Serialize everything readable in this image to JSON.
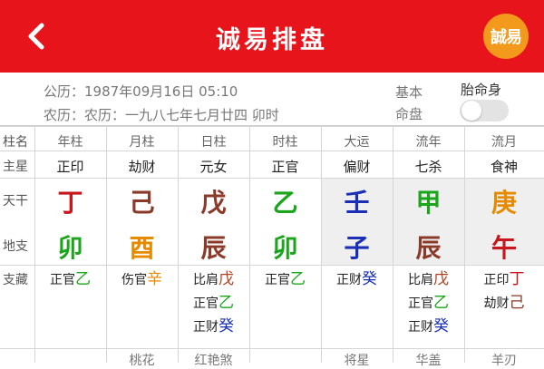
{
  "header": {
    "title": "诚易排盘",
    "logo_text": "誠易",
    "bg": "#e8141c"
  },
  "info": {
    "solar": "公历：1987年09月16日 05:10",
    "lunar": "农历：农历：一九八七年七月廿四 卯时",
    "basic_line1": "基本",
    "basic_line2": "命盘",
    "body_label": "胎命身"
  },
  "row_labels": {
    "name": "柱名",
    "star": "主星",
    "tiangan": "天干",
    "dizhi": "地支",
    "hidden": "支藏"
  },
  "columns": [
    {
      "name": "年柱",
      "star": "正印",
      "gan": "丁",
      "gan_color": "#c8161d",
      "zhi": "卯",
      "zhi_color": "#1aa51a",
      "hidden": [
        {
          "god": "正官",
          "ch": "乙",
          "color": "#1aa51a"
        }
      ],
      "bottom": ""
    },
    {
      "name": "月柱",
      "star": "劫财",
      "gan": "己",
      "gan_color": "#8b3a2a",
      "zhi": "酉",
      "zhi_color": "#e68a00",
      "hidden": [
        {
          "god": "伤官",
          "ch": "辛",
          "color": "#e68a00"
        }
      ],
      "bottom": "桃花"
    },
    {
      "name": "日柱",
      "star": "元女",
      "gan": "戊",
      "gan_color": "#8b3a2a",
      "zhi": "辰",
      "zhi_color": "#8b3a2a",
      "hidden": [
        {
          "god": "比肩",
          "ch": "戊",
          "color": "#b5401f"
        },
        {
          "god": "正官",
          "ch": "乙",
          "color": "#1aa51a"
        },
        {
          "god": "正财",
          "ch": "癸",
          "color": "#1a2fb5"
        }
      ],
      "bottom": "红艳煞"
    },
    {
      "name": "时柱",
      "star": "正官",
      "gan": "乙",
      "gan_color": "#1aa51a",
      "zhi": "卯",
      "zhi_color": "#1aa51a",
      "hidden": [
        {
          "god": "正官",
          "ch": "乙",
          "color": "#1aa51a"
        }
      ],
      "bottom": ""
    },
    {
      "name": "大运",
      "star": "偏财",
      "gan": "壬",
      "gan_color": "#1a2fb5",
      "zhi": "子",
      "zhi_color": "#1a2fb5",
      "hidden": [
        {
          "god": "正财",
          "ch": "癸",
          "color": "#1a2fb5"
        }
      ],
      "bottom": "将星"
    },
    {
      "name": "流年",
      "star": "七杀",
      "gan": "甲",
      "gan_color": "#1aa51a",
      "zhi": "辰",
      "zhi_color": "#8b3a2a",
      "hidden": [
        {
          "god": "比肩",
          "ch": "戊",
          "color": "#b5401f"
        },
        {
          "god": "正官",
          "ch": "乙",
          "color": "#1aa51a"
        },
        {
          "god": "正财",
          "ch": "癸",
          "color": "#1a2fb5"
        }
      ],
      "bottom": "华盖"
    },
    {
      "name": "流月",
      "star": "食神",
      "gan": "庚",
      "gan_color": "#e68a00",
      "zhi": "午",
      "zhi_color": "#c8161d",
      "hidden": [
        {
          "god": "正印",
          "ch": "丁",
          "color": "#c8161d"
        },
        {
          "god": "劫财",
          "ch": "己",
          "color": "#8b3a2a"
        }
      ],
      "bottom": "羊刃"
    }
  ]
}
